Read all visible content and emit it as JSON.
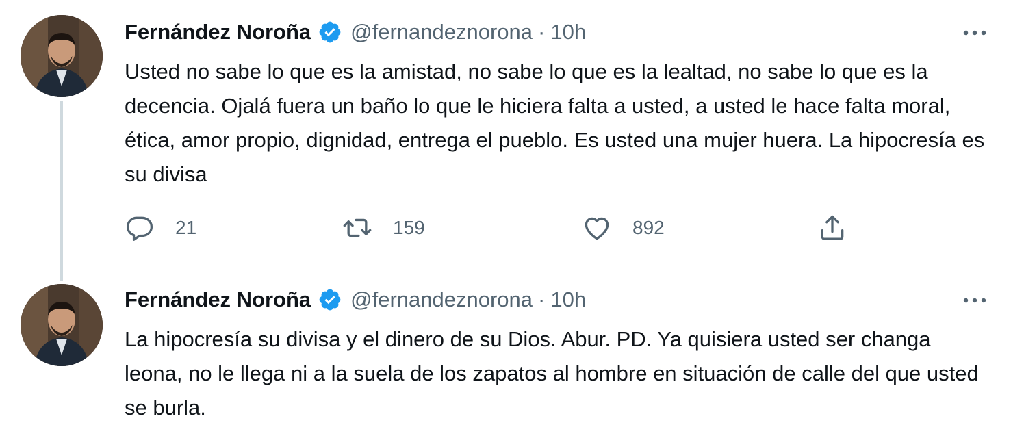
{
  "tweets": [
    {
      "author": {
        "display_name": "Fernández Noroña",
        "handle": "@fernandeznorona",
        "verified": true
      },
      "separator": "·",
      "time": "10h",
      "text": "Usted no sabe lo que es la amistad, no sabe lo que es la lealtad, no sabe lo que es la decencia. Ojalá fuera un baño lo que le hiciera falta a usted, a usted le hace falta moral, ética, amor propio, dignidad, entrega el pueblo. Es usted una mujer huera. La hipocresía es su divisa",
      "stats": {
        "replies": "21",
        "retweets": "159",
        "likes": "892"
      }
    },
    {
      "author": {
        "display_name": "Fernández Noroña",
        "handle": "@fernandeznorona",
        "verified": true
      },
      "separator": "·",
      "time": "10h",
      "text": "La hipocresía su divisa y el dinero de su Dios. Abur. PD. Ya quisiera usted ser changa leona, no le llega ni a la suela de los zapatos al hombre en situación de calle del que usted se burla."
    }
  ],
  "icons": {
    "verified": "verified-badge-icon",
    "more": "more-options-icon",
    "reply": "reply-icon",
    "retweet": "retweet-icon",
    "like": "heart-icon",
    "share": "share-icon"
  },
  "colors": {
    "verified_blue": "#1d9bf0",
    "text_primary": "#0f1419",
    "text_secondary": "#536471",
    "thread_line": "#cfd9de"
  }
}
